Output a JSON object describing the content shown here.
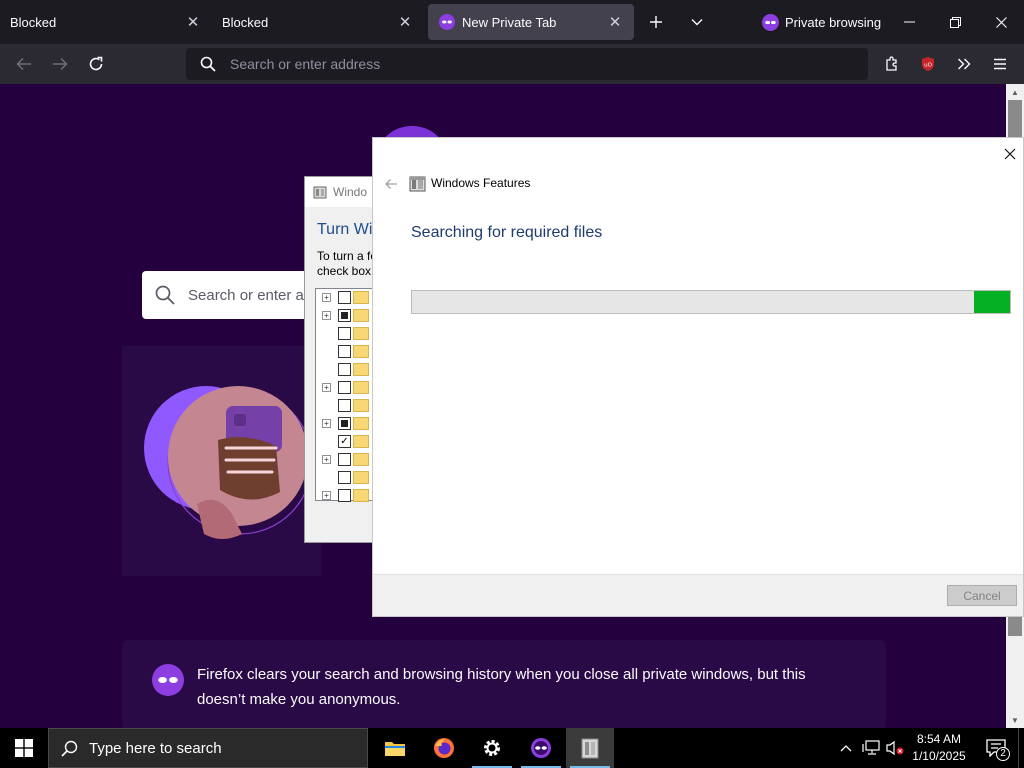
{
  "browser": {
    "tabs": [
      {
        "label": "Blocked",
        "active": false
      },
      {
        "label": "Blocked",
        "active": false
      },
      {
        "label": "New Private Tab",
        "active": true
      }
    ],
    "private_label": "Private browsing",
    "address_placeholder": "Search or enter address",
    "colors": {
      "chrome": "#1c1b22",
      "toolbar": "#2b2a33",
      "private_accent": "#8d3ee0",
      "ublock_red": "#c3252b"
    }
  },
  "page": {
    "search_placeholder": "Search or enter ad",
    "info_text": "Firefox clears your search and browsing history when you close all private windows, but this doesn’t make you anonymous.",
    "background": "#25003e"
  },
  "features_dialog": {
    "title": "Windo",
    "heading": "Turn Wi",
    "description_line1": "To turn a fe",
    "description_line2": "check box",
    "tree_items": [
      {
        "expand": true,
        "state": "unchecked"
      },
      {
        "expand": true,
        "state": "partial"
      },
      {
        "expand": false,
        "state": "unchecked"
      },
      {
        "expand": false,
        "state": "unchecked"
      },
      {
        "expand": false,
        "state": "unchecked"
      },
      {
        "expand": true,
        "state": "unchecked"
      },
      {
        "expand": false,
        "state": "unchecked"
      },
      {
        "expand": true,
        "state": "partial"
      },
      {
        "expand": false,
        "state": "checked"
      },
      {
        "expand": true,
        "state": "unchecked"
      },
      {
        "expand": false,
        "state": "unchecked"
      },
      {
        "expand": true,
        "state": "unchecked"
      }
    ]
  },
  "wf_dialog": {
    "title": "Windows Features",
    "status": "Searching for required files",
    "progress_segment_start": 0.94,
    "progress_segment_end": 1.0,
    "progress_color": "#06b025",
    "cancel_label": "Cancel",
    "cancel_enabled": false
  },
  "taskbar": {
    "search_placeholder": "Type here to search",
    "apps": [
      {
        "name": "file-explorer",
        "running": false
      },
      {
        "name": "firefox",
        "running": false
      },
      {
        "name": "settings",
        "running": true
      },
      {
        "name": "firefox-private",
        "running": true
      },
      {
        "name": "windows-features",
        "running": true,
        "active": true
      }
    ],
    "time": "8:54 AM",
    "date": "1/10/2025",
    "notification_count": "2"
  }
}
